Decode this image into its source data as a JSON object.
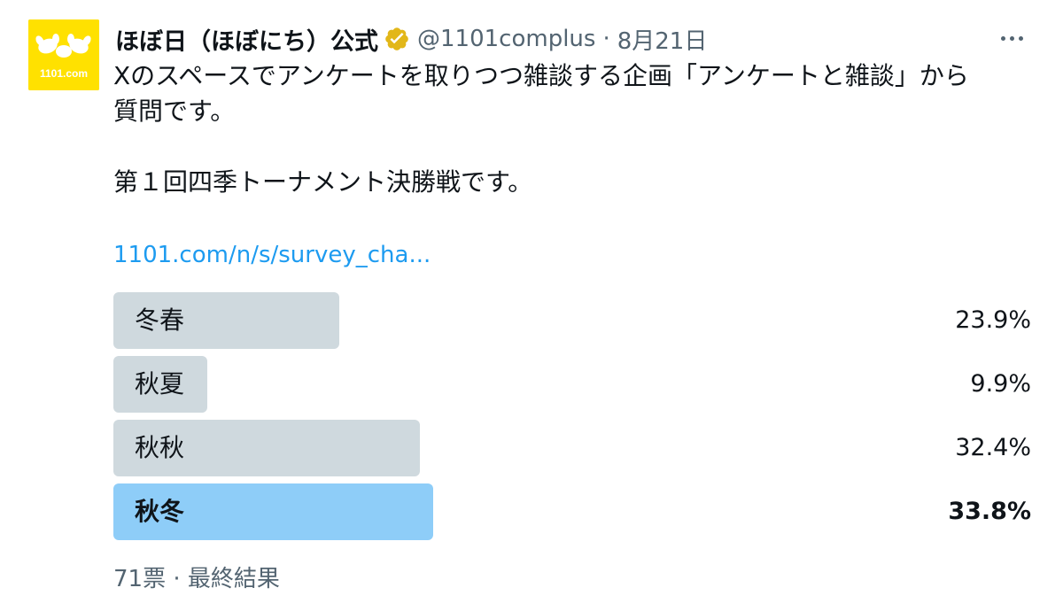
{
  "author": {
    "avatar_text": "1101.com",
    "display_name": "ほぼ日（ほぼにち）公式",
    "handle": "@1101complus",
    "separator": "·",
    "timestamp": "8月21日"
  },
  "tweet": {
    "text_lines": [
      "Xのスペースでアンケートを取りつつ雑談する企画「アンケートと雑談」から",
      "質問です。",
      "",
      "第１回四季トーナメント決勝戦です。"
    ],
    "link_text": "1101.com/n/s/survey_cha..."
  },
  "poll": {
    "options": [
      {
        "label": "冬春",
        "percent_text": "23.9%",
        "percent": 23.9,
        "winner": false
      },
      {
        "label": "秋夏",
        "percent_text": "9.9%",
        "percent": 9.9,
        "winner": false
      },
      {
        "label": "秋秋",
        "percent_text": "32.4%",
        "percent": 32.4,
        "winner": false
      },
      {
        "label": "秋冬",
        "percent_text": "33.8%",
        "percent": 33.8,
        "winner": true
      }
    ],
    "footer": "71票 · 最終結果"
  },
  "icons": {
    "verified": "verified-badge-gold-icon",
    "more": "more-horizontal-icon"
  },
  "colors": {
    "link": "#1d9bf0",
    "secondary_text": "#536471",
    "poll_bar": "#cfd9de",
    "poll_bar_winner": "#8ecdf8",
    "verified_badge": "#e2b719",
    "avatar_bg": "#ffe100"
  }
}
